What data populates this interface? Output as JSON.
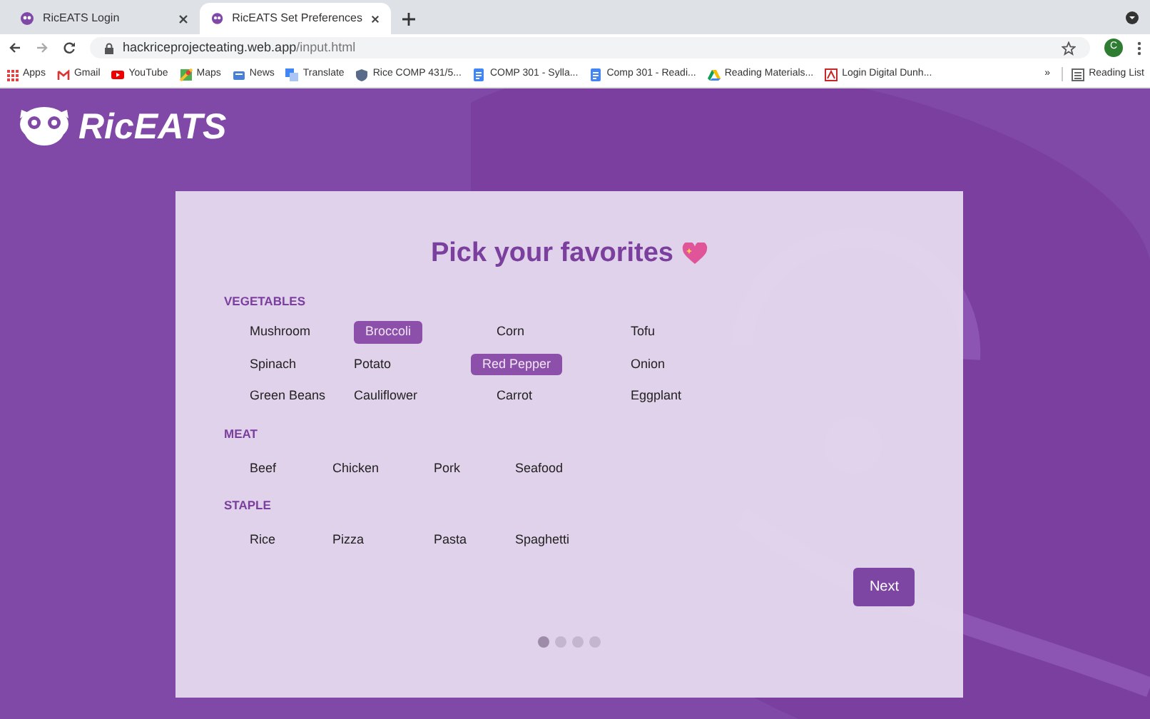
{
  "browser": {
    "tabs": [
      {
        "title": "RicEATS Login",
        "selected": false
      },
      {
        "title": "RicEATS Set Preferences",
        "selected": true
      }
    ],
    "url": {
      "host": "hackriceprojecteating.web.app",
      "path": "/input.html"
    },
    "profile": "C",
    "bookmarks": [
      {
        "label": "Apps"
      },
      {
        "label": "Gmail"
      },
      {
        "label": "YouTube"
      },
      {
        "label": "Maps"
      },
      {
        "label": "News"
      },
      {
        "label": "Translate"
      },
      {
        "label": "Rice COMP 431/5..."
      },
      {
        "label": "COMP 301 - Sylla..."
      },
      {
        "label": "Comp 301 - Readi..."
      },
      {
        "label": "Reading Materials..."
      },
      {
        "label": "Login Digital Dunh..."
      }
    ],
    "overflow": "»",
    "reading_list": "Reading List"
  },
  "logo": "RicEATS",
  "card": {
    "title": "Pick your favorites",
    "sections": [
      {
        "heading": "VEGETABLES",
        "kind": "grid",
        "items": [
          {
            "label": "Mushroom",
            "selected": false
          },
          {
            "label": "Broccoli",
            "selected": true
          },
          {
            "label": "Corn",
            "selected": false
          },
          {
            "label": "Tofu",
            "selected": false
          },
          {
            "label": "Spinach",
            "selected": false
          },
          {
            "label": "Potato",
            "selected": false
          },
          {
            "label": "Red Pepper",
            "selected": true
          },
          {
            "label": "Onion",
            "selected": false
          },
          {
            "label": "Green Beans",
            "selected": false
          },
          {
            "label": "Cauliflower",
            "selected": false
          },
          {
            "label": "Carrot",
            "selected": false
          },
          {
            "label": "Eggplant",
            "selected": false
          }
        ]
      },
      {
        "heading": "MEAT",
        "kind": "row",
        "items": [
          {
            "label": "Beef",
            "selected": false
          },
          {
            "label": "Chicken",
            "selected": false
          },
          {
            "label": "Pork",
            "selected": false
          },
          {
            "label": "Seafood",
            "selected": false
          }
        ]
      },
      {
        "heading": "STAPLE",
        "kind": "row",
        "items": [
          {
            "label": "Rice",
            "selected": false
          },
          {
            "label": "Pizza",
            "selected": false
          },
          {
            "label": "Pasta",
            "selected": false
          },
          {
            "label": "Spaghetti",
            "selected": false
          }
        ]
      }
    ],
    "next": "Next",
    "pages": [
      {
        "selected": true
      },
      {
        "selected": false
      },
      {
        "selected": false
      },
      {
        "selected": false
      }
    ]
  }
}
